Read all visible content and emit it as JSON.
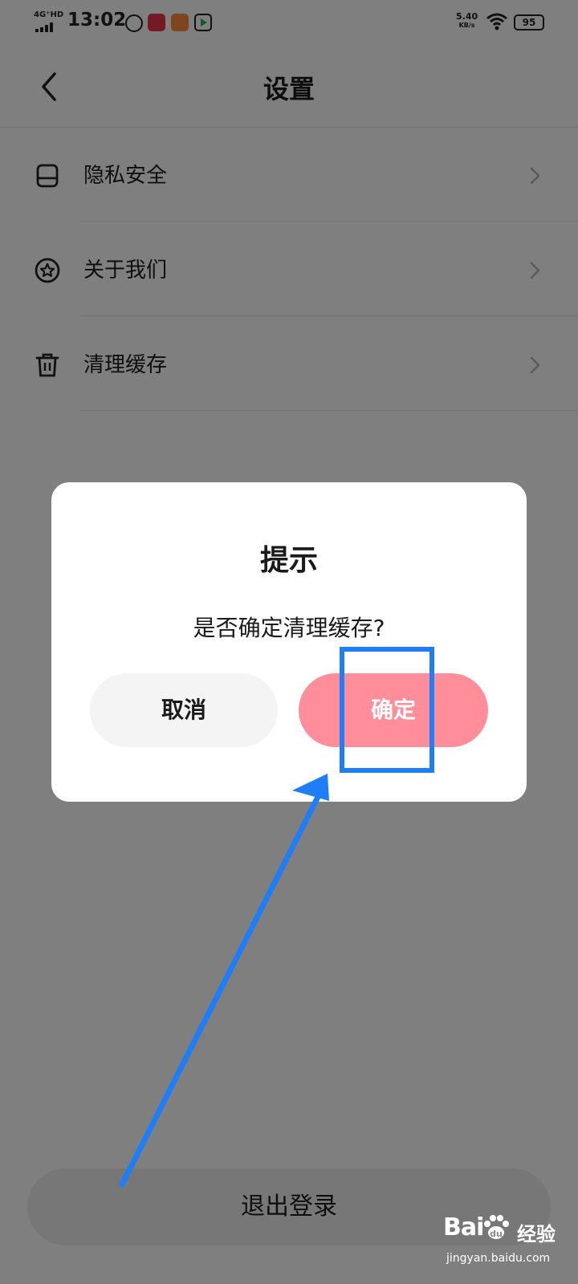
{
  "status_bar": {
    "network": "4G⁺HD",
    "time": "13:02",
    "speed_value": "5.40",
    "speed_unit": "KB/s",
    "battery": "95",
    "app_icons": [
      "circle-l-icon",
      "red-app-icon",
      "orange-app-icon",
      "green-play-app-icon"
    ]
  },
  "header": {
    "title": "设置",
    "back_icon": "chevron-left-icon"
  },
  "settings": {
    "items": [
      {
        "label": "隐私安全",
        "icon": "privacy-box-icon"
      },
      {
        "label": "关于我们",
        "icon": "star-circle-icon"
      },
      {
        "label": "清理缓存",
        "icon": "trash-icon"
      }
    ]
  },
  "logout": {
    "label": "退出登录"
  },
  "dialog": {
    "title": "提示",
    "message": "是否确定清理缓存?",
    "cancel_label": "取消",
    "confirm_label": "确定"
  },
  "watermark": {
    "logo": "Bai",
    "logo_tail": "经验",
    "url": "jingyan.baidu.com"
  },
  "colors": {
    "confirm": "#ff8e9a",
    "annotation": "#1f7ef6",
    "overlay": "rgba(0,0,0,0.5)"
  }
}
